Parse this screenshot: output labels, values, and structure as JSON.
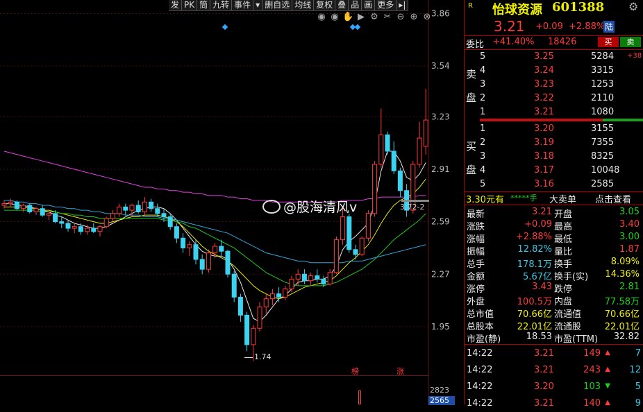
{
  "toolbar": [
    "发",
    "PK",
    "筒",
    "九转",
    "事件",
    "▾",
    "删自选",
    "均线",
    "复权",
    "叠",
    "品",
    "画",
    "更多",
    "▸|"
  ],
  "stock": {
    "name": "怡球资源",
    "code": "601388",
    "tag": "R",
    "price": "3.21",
    "change": "+0.09",
    "pct": "+2.88%",
    "flag": "陆"
  },
  "weibi": {
    "label": "委比",
    "ratio": "+41.40%",
    "diff": "18426",
    "buy_btn": "买",
    "sell_btn": "卖"
  },
  "ask": {
    "group_label": [
      "卖",
      "盘"
    ],
    "rows": [
      {
        "n": "5",
        "price": "3.25",
        "vol": "5284",
        "extra": "+38"
      },
      {
        "n": "4",
        "price": "3.24",
        "vol": "3315",
        "extra": ""
      },
      {
        "n": "3",
        "price": "3.23",
        "vol": "1253",
        "extra": ""
      },
      {
        "n": "2",
        "price": "3.22",
        "vol": "2110",
        "extra": ""
      },
      {
        "n": "1",
        "price": "3.21",
        "vol": "1080",
        "extra": ""
      }
    ]
  },
  "bid": {
    "group_label": [
      "买",
      "盘"
    ],
    "rows": [
      {
        "n": "1",
        "price": "3.20",
        "vol": "3155"
      },
      {
        "n": "2",
        "price": "3.19",
        "vol": "7355"
      },
      {
        "n": "3",
        "price": "3.18",
        "vol": "8325"
      },
      {
        "n": "4",
        "price": "3.17",
        "vol": "10048"
      },
      {
        "n": "5",
        "price": "3.16",
        "vol": "2585"
      }
    ]
  },
  "order_bar": {
    "left": "3.30元有",
    "stars": "*****手",
    "big": "大卖单",
    "link": "点击查看"
  },
  "stats": [
    {
      "l1": "最新",
      "v1": "3.21",
      "c1": "red",
      "l2": "开盘",
      "v2": "3.05",
      "c2": "grn"
    },
    {
      "l1": "涨跌",
      "v1": "+0.09",
      "c1": "red",
      "l2": "最高",
      "v2": "3.40",
      "c2": "red"
    },
    {
      "l1": "涨幅",
      "v1": "+2.88%",
      "c1": "red",
      "l2": "最低",
      "v2": "3.00",
      "c2": "grn"
    },
    {
      "l1": "振幅",
      "v1": "12.82%",
      "c1": "cyan",
      "l2": "量比",
      "v2": "1.87",
      "c2": "red"
    },
    {
      "l1": "总手",
      "v1": "178.1万",
      "c1": "cyan",
      "l2": "换手",
      "v2": "8.09%",
      "c2": "yel"
    },
    {
      "l1": "金额",
      "v1": "5.67亿",
      "c1": "cyan",
      "l2": "换手(实)",
      "v2": "14.36%",
      "c2": "yel"
    },
    {
      "l1": "涨停",
      "v1": "3.43",
      "c1": "red",
      "l2": "跌停",
      "v2": "2.81",
      "c2": "grn"
    },
    {
      "l1": "外盘",
      "v1": "100.5万",
      "c1": "red",
      "l2": "内盘",
      "v2": "77.58万",
      "c2": "grn"
    },
    {
      "l1": "总市值",
      "v1": "70.66亿",
      "c1": "yel",
      "l2": "流通值",
      "v2": "70.66亿",
      "c2": "yel"
    },
    {
      "l1": "总股本",
      "v1": "22.01亿",
      "c1": "yel",
      "l2": "流通股",
      "v2": "22.01亿",
      "c2": "yel"
    },
    {
      "l1": "市盈(静)",
      "v1": "18.53",
      "c1": "wht",
      "l2": "市盈(TTM)",
      "v2": "32.82",
      "c2": "wht"
    }
  ],
  "ticks": [
    {
      "time": "14:22",
      "price": "3.21",
      "vol": "149",
      "dir": "up",
      "n": "7"
    },
    {
      "time": "14:22",
      "price": "3.21",
      "vol": "243",
      "dir": "up",
      "n": "12"
    },
    {
      "time": "14:22",
      "price": "3.20",
      "vol": "103",
      "dir": "down",
      "n": "5"
    },
    {
      "time": "14:22",
      "price": "3.21",
      "vol": "140",
      "dir": "up",
      "n": "9"
    }
  ],
  "chart_labels": {
    "low": "1.74",
    "ma_tag": "3.72-2",
    "bang": "榜",
    "zhang": "涨",
    "vol_hi": "2823",
    "vol_lo": "2565"
  },
  "watermark": "@股海清风v",
  "chart_data": {
    "type": "candlestick",
    "yticks": [
      "3.86",
      "3.54",
      "3.23",
      "2.91",
      "2.59",
      "2.27",
      "1.95"
    ],
    "ylim": [
      1.7,
      3.9
    ],
    "candles": [
      [
        2.69,
        2.72,
        2.67,
        2.7
      ],
      [
        2.7,
        2.73,
        2.68,
        2.71
      ],
      [
        2.71,
        2.72,
        2.66,
        2.67
      ],
      [
        2.67,
        2.7,
        2.65,
        2.69
      ],
      [
        2.69,
        2.7,
        2.64,
        2.65
      ],
      [
        2.65,
        2.68,
        2.63,
        2.67
      ],
      [
        2.67,
        2.69,
        2.62,
        2.63
      ],
      [
        2.63,
        2.66,
        2.6,
        2.64
      ],
      [
        2.64,
        2.66,
        2.58,
        2.59
      ],
      [
        2.59,
        2.62,
        2.55,
        2.58
      ],
      [
        2.58,
        2.6,
        2.53,
        2.55
      ],
      [
        2.55,
        2.58,
        2.52,
        2.56
      ],
      [
        2.56,
        2.58,
        2.51,
        2.53
      ],
      [
        2.53,
        2.57,
        2.51,
        2.55
      ],
      [
        2.55,
        2.58,
        2.52,
        2.53
      ],
      [
        2.53,
        2.57,
        2.5,
        2.56
      ],
      [
        2.56,
        2.62,
        2.55,
        2.61
      ],
      [
        2.61,
        2.66,
        2.59,
        2.64
      ],
      [
        2.64,
        2.7,
        2.62,
        2.68
      ],
      [
        2.68,
        2.7,
        2.63,
        2.66
      ],
      [
        2.66,
        2.7,
        2.62,
        2.69
      ],
      [
        2.69,
        2.72,
        2.64,
        2.65
      ],
      [
        2.65,
        2.74,
        2.63,
        2.71
      ],
      [
        2.71,
        2.73,
        2.65,
        2.67
      ],
      [
        2.67,
        2.7,
        2.62,
        2.64
      ],
      [
        2.64,
        2.67,
        2.59,
        2.62
      ],
      [
        2.62,
        2.64,
        2.54,
        2.56
      ],
      [
        2.56,
        2.58,
        2.46,
        2.49
      ],
      [
        2.49,
        2.52,
        2.4,
        2.43
      ],
      [
        2.43,
        2.47,
        2.38,
        2.45
      ],
      [
        2.45,
        2.48,
        2.33,
        2.36
      ],
      [
        2.36,
        2.39,
        2.27,
        2.3
      ],
      [
        2.3,
        2.42,
        2.28,
        2.4
      ],
      [
        2.4,
        2.46,
        2.37,
        2.44
      ],
      [
        2.44,
        2.48,
        2.38,
        2.41
      ],
      [
        2.41,
        2.42,
        2.25,
        2.27
      ],
      [
        2.27,
        2.29,
        2.1,
        2.13
      ],
      [
        2.13,
        2.15,
        1.98,
        2.02
      ],
      [
        2.02,
        2.04,
        1.8,
        1.84
      ],
      [
        1.84,
        1.96,
        1.74,
        1.94
      ],
      [
        1.94,
        2.1,
        1.92,
        2.07
      ],
      [
        2.07,
        2.15,
        2.03,
        2.12
      ],
      [
        2.12,
        2.18,
        2.08,
        2.15
      ],
      [
        2.15,
        2.19,
        2.1,
        2.13
      ],
      [
        2.13,
        2.2,
        2.11,
        2.18
      ],
      [
        2.18,
        2.26,
        2.16,
        2.24
      ],
      [
        2.24,
        2.3,
        2.2,
        2.27
      ],
      [
        2.27,
        2.3,
        2.21,
        2.23
      ],
      [
        2.23,
        2.28,
        2.2,
        2.26
      ],
      [
        2.26,
        2.3,
        2.22,
        2.24
      ],
      [
        2.24,
        2.26,
        2.19,
        2.21
      ],
      [
        2.21,
        2.3,
        2.2,
        2.28
      ],
      [
        2.28,
        2.5,
        2.27,
        2.48
      ],
      [
        2.48,
        2.68,
        2.45,
        2.62
      ],
      [
        2.62,
        2.64,
        2.4,
        2.42
      ],
      [
        2.42,
        2.45,
        2.36,
        2.39
      ],
      [
        2.39,
        2.5,
        2.38,
        2.49
      ],
      [
        2.49,
        2.66,
        2.47,
        2.64
      ],
      [
        2.64,
        2.96,
        2.62,
        2.94
      ],
      [
        2.94,
        3.28,
        2.92,
        3.12
      ],
      [
        3.12,
        3.14,
        3.0,
        3.02
      ],
      [
        3.02,
        3.08,
        2.88,
        2.9
      ],
      [
        2.9,
        2.92,
        2.74,
        2.78
      ],
      [
        2.78,
        2.82,
        2.62,
        2.66
      ],
      [
        2.66,
        2.96,
        2.64,
        2.94
      ],
      [
        2.94,
        3.2,
        2.92,
        3.1
      ],
      [
        3.05,
        3.4,
        3.0,
        3.21
      ]
    ],
    "ma_series": [
      {
        "color": "#e8e8e8",
        "values": [
          2.7,
          2.7,
          2.69,
          2.69,
          2.68,
          2.67,
          2.66,
          2.65,
          2.63,
          2.62,
          2.6,
          2.58,
          2.57,
          2.56,
          2.55,
          2.55,
          2.56,
          2.58,
          2.6,
          2.62,
          2.64,
          2.66,
          2.67,
          2.68,
          2.68,
          2.67,
          2.64,
          2.6,
          2.55,
          2.5,
          2.45,
          2.41,
          2.39,
          2.38,
          2.38,
          2.36,
          2.3,
          2.22,
          2.11,
          2.0,
          1.98,
          2.02,
          2.07,
          2.12,
          2.14,
          2.18,
          2.22,
          2.23,
          2.23,
          2.24,
          2.24,
          2.26,
          2.32,
          2.42,
          2.47,
          2.5,
          2.54,
          2.58,
          2.7,
          2.9,
          3.02,
          3.02,
          2.96,
          2.86,
          2.84,
          2.88,
          2.95
        ]
      },
      {
        "color": "#e8e800",
        "values": [
          2.68,
          2.68,
          2.68,
          2.68,
          2.67,
          2.67,
          2.66,
          2.66,
          2.65,
          2.64,
          2.63,
          2.62,
          2.61,
          2.6,
          2.59,
          2.58,
          2.58,
          2.59,
          2.6,
          2.61,
          2.62,
          2.62,
          2.63,
          2.63,
          2.63,
          2.62,
          2.61,
          2.59,
          2.56,
          2.52,
          2.48,
          2.44,
          2.41,
          2.39,
          2.37,
          2.35,
          2.32,
          2.28,
          2.24,
          2.2,
          2.17,
          2.15,
          2.13,
          2.12,
          2.13,
          2.15,
          2.17,
          2.19,
          2.2,
          2.21,
          2.22,
          2.23,
          2.26,
          2.3,
          2.34,
          2.37,
          2.41,
          2.45,
          2.51,
          2.58,
          2.64,
          2.69,
          2.72,
          2.74,
          2.76,
          2.8,
          2.85
        ]
      },
      {
        "color": "#e040e0",
        "values": [
          3.02,
          3.01,
          3.0,
          2.99,
          2.98,
          2.97,
          2.96,
          2.95,
          2.94,
          2.93,
          2.92,
          2.91,
          2.9,
          2.89,
          2.88,
          2.87,
          2.86,
          2.85,
          2.84,
          2.83,
          2.82,
          2.81,
          2.8,
          2.8,
          2.79,
          2.79,
          2.78,
          2.78,
          2.77,
          2.77,
          2.76,
          2.76,
          2.75,
          2.75,
          2.75,
          2.74,
          2.74,
          2.73,
          2.73,
          2.72,
          2.72,
          2.72,
          2.71,
          2.71,
          2.71,
          2.71,
          2.71,
          2.71,
          2.71,
          2.71,
          2.71,
          2.71,
          2.71,
          2.72,
          2.72,
          2.72,
          2.72,
          2.73,
          2.73,
          2.74,
          2.74,
          2.74,
          2.74,
          2.74,
          2.74,
          2.75,
          2.75
        ]
      },
      {
        "color": "#1fc81f",
        "values": [
          2.66,
          2.66,
          2.66,
          2.66,
          2.66,
          2.66,
          2.65,
          2.65,
          2.65,
          2.64,
          2.64,
          2.63,
          2.63,
          2.62,
          2.62,
          2.61,
          2.61,
          2.61,
          2.61,
          2.61,
          2.61,
          2.61,
          2.61,
          2.61,
          2.61,
          2.6,
          2.6,
          2.59,
          2.58,
          2.56,
          2.55,
          2.53,
          2.51,
          2.49,
          2.47,
          2.45,
          2.43,
          2.4,
          2.37,
          2.34,
          2.31,
          2.28,
          2.26,
          2.24,
          2.22,
          2.21,
          2.2,
          2.2,
          2.2,
          2.2,
          2.2,
          2.21,
          2.22,
          2.24,
          2.26,
          2.28,
          2.3,
          2.33,
          2.36,
          2.4,
          2.44,
          2.48,
          2.51,
          2.54,
          2.57,
          2.6,
          2.64
        ]
      },
      {
        "color": "#2fa7d8",
        "values": [
          2.72,
          2.72,
          2.71,
          2.71,
          2.7,
          2.7,
          2.69,
          2.69,
          2.68,
          2.68,
          2.67,
          2.67,
          2.66,
          2.66,
          2.65,
          2.65,
          2.64,
          2.64,
          2.64,
          2.63,
          2.63,
          2.63,
          2.62,
          2.62,
          2.62,
          2.61,
          2.61,
          2.6,
          2.59,
          2.58,
          2.57,
          2.56,
          2.55,
          2.54,
          2.53,
          2.52,
          2.5,
          2.48,
          2.46,
          2.44,
          2.42,
          2.4,
          2.39,
          2.38,
          2.37,
          2.36,
          2.35,
          2.35,
          2.34,
          2.34,
          2.34,
          2.34,
          2.34,
          2.34,
          2.35,
          2.35,
          2.35,
          2.36,
          2.37,
          2.38,
          2.39,
          2.4,
          2.41,
          2.42,
          2.43,
          2.44,
          2.45
        ]
      }
    ],
    "volume_tail": [
      2823,
      2565
    ]
  }
}
